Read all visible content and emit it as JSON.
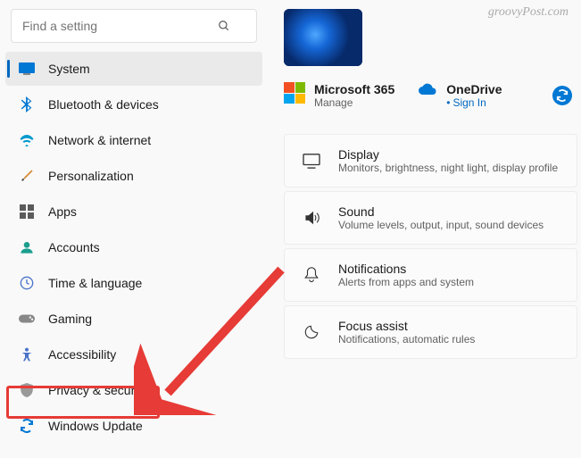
{
  "watermark": "groovyPost.com",
  "search": {
    "placeholder": "Find a setting"
  },
  "sidebar": {
    "items": [
      {
        "label": "System",
        "icon": "system"
      },
      {
        "label": "Bluetooth & devices",
        "icon": "bluetooth"
      },
      {
        "label": "Network & internet",
        "icon": "wifi"
      },
      {
        "label": "Personalization",
        "icon": "brush"
      },
      {
        "label": "Apps",
        "icon": "apps"
      },
      {
        "label": "Accounts",
        "icon": "person"
      },
      {
        "label": "Time & language",
        "icon": "clock"
      },
      {
        "label": "Gaming",
        "icon": "gaming"
      },
      {
        "label": "Accessibility",
        "icon": "accessibility"
      },
      {
        "label": "Privacy & security",
        "icon": "shield"
      },
      {
        "label": "Windows Update",
        "icon": "update"
      }
    ]
  },
  "accounts": {
    "ms365": {
      "title": "Microsoft 365",
      "sub": "Manage"
    },
    "onedrive": {
      "title": "OneDrive",
      "sub": "Sign In"
    }
  },
  "panels": [
    {
      "icon": "display",
      "title": "Display",
      "sub": "Monitors, brightness, night light, display profile"
    },
    {
      "icon": "sound",
      "title": "Sound",
      "sub": "Volume levels, output, input, sound devices"
    },
    {
      "icon": "notifications",
      "title": "Notifications",
      "sub": "Alerts from apps and system"
    },
    {
      "icon": "focus",
      "title": "Focus assist",
      "sub": "Notifications, automatic rules"
    }
  ],
  "annotation": {
    "target": "Privacy & security"
  }
}
